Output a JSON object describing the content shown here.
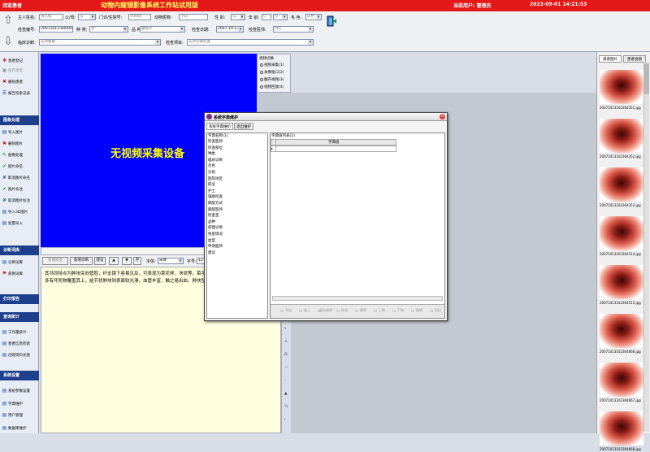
{
  "titlebar": {
    "left": "浏览患者",
    "title": "动物内窥镜影像系统工作站试用版",
    "user": "当前用户: 管理员",
    "datetime": "2023-09-01 14:21:53"
  },
  "header": {
    "owner_label": "主人姓名:",
    "owner_value": "钱礼松",
    "gender_label": "公/母:",
    "gender_value": "公",
    "outpatient_label": "门诊/住院号:",
    "outpatient_value": "00000",
    "animal_label": "动物昵称:",
    "animal_value": "小白",
    "sex_label": "性 别:",
    "sex_value": "公",
    "age_label": "年 龄:",
    "age_value": "0",
    "unit_value": "岁",
    "color_label": "毛 色:",
    "color_value": "白色",
    "exam_no_label": "检查编号:",
    "exam_no_value": "20071013-000001",
    "species_label": "种 类:",
    "species_value": "狗",
    "breed_label": "品 种:",
    "breed_value": "藏獒犬",
    "exam_date_label": "检查日期:",
    "exam_date_value": "2007-10-13",
    "doctor_label": "检查医师:",
    "doctor_value": "孙亿",
    "diag_label": "临床诊断:",
    "diag_value": "支持报警",
    "item_label": "检查项目:",
    "item_value": "支持内镜检查"
  },
  "sidebar": {
    "group1": [
      {
        "icon": "✚",
        "label": "患者登记"
      },
      {
        "icon": "▣",
        "label": "保存患者"
      },
      {
        "icon": "✖",
        "label": "删除患者"
      },
      {
        "icon": "☰",
        "label": "报告检索记录"
      }
    ],
    "sec_image": "图象处理",
    "group2": [
      {
        "icon": "▤",
        "label": "导入图片"
      },
      {
        "icon": "✖",
        "label": "删除图片"
      },
      {
        "icon": "✎",
        "label": "图像处理"
      },
      {
        "icon": "✔",
        "label": "图片命名"
      },
      {
        "icon": "✘",
        "label": "取消图片命名"
      },
      {
        "icon": "✔",
        "label": "图片标注"
      },
      {
        "icon": "✘",
        "label": "取消图片标注"
      },
      {
        "icon": "▤",
        "label": "导入3D图片"
      },
      {
        "icon": "▤",
        "label": "批量导入"
      }
    ],
    "sec_diag": "诊断词库",
    "group3": [
      {
        "icon": "▤",
        "label": "诊断词库"
      },
      {
        "icon": "⚑",
        "label": "病例词库"
      }
    ],
    "sec_print": "打印报告",
    "sec_stats": "查询统计",
    "group4": [
      {
        "icon": "▤",
        "label": "工作量统计"
      },
      {
        "icon": "▤",
        "label": "患者信息检索"
      },
      {
        "icon": "▤",
        "label": "创建资料光盘"
      }
    ],
    "sec_settings": "系统设置",
    "group5": [
      {
        "icon": "▤",
        "label": "系统参数设置"
      },
      {
        "icon": "▤",
        "label": "字典维护"
      },
      {
        "icon": "▤",
        "label": "用户管理"
      },
      {
        "icon": "▤",
        "label": "数据库维护"
      }
    ]
  },
  "video": {
    "no_device": "无视频采集设备"
  },
  "video_ctl": {
    "title": "视频切换",
    "options": [
      "视频采集(1)",
      "录像窗口(2)",
      "翻开视频(3)",
      "视频回放(4)"
    ]
  },
  "toolbar": {
    "btn1": "新增病变",
    "btn2": "新增诊断",
    "btn3": "建议",
    "btn4": "▲",
    "btn5": "▼",
    "btn6": "存",
    "font_label": "字体:",
    "font_value": "宋体",
    "size_label": "字号:",
    "size_value": "12"
  },
  "report_text": "其共同特点为肿块突向管腔，纤支镜下容易见及，可表现为菜花样，块状等，菜花样肿块表面均凹凸不平，多有坏死物覆盖其上，结节状肿块则表面较光滑，血管丰富，触之易出血。肿块型大多属管内型。",
  "right_panel": {
    "tab1": "患者图片",
    "tab2": "患者视频",
    "thumbs": [
      "20071013102364351.jpg",
      "20071013102364352.jpg",
      "20071013102364353.jpg",
      "20071013102364514.jpg",
      "20071013102364515.jpg",
      "20071013102364666.jpg",
      "20071013102364667.jpg",
      "20071013102364668.jpg"
    ]
  },
  "dialog": {
    "title": "系统字典维护",
    "tab1": "系统字典维护",
    "tab2": "退出维护",
    "list_header": "字典名称(1)",
    "items": [
      "检查医师",
      "检查部位",
      "种类",
      "临床诊断",
      "毛色",
      "诊别",
      "医院地区",
      "职业",
      "护士",
      "辅助检查",
      "麻醉方式",
      "麻醉医师",
      "检查室",
      "品种",
      "病理诊断",
      "免疫情况",
      "血型",
      "申请医师",
      "建议"
    ],
    "value_header": "字典值列表(2)",
    "col_header": "字典值",
    "buttons": [
      "添加",
      "插入",
      "保存修改",
      "修改",
      "删除",
      "上移",
      "下移",
      "撤销",
      "退出"
    ]
  }
}
